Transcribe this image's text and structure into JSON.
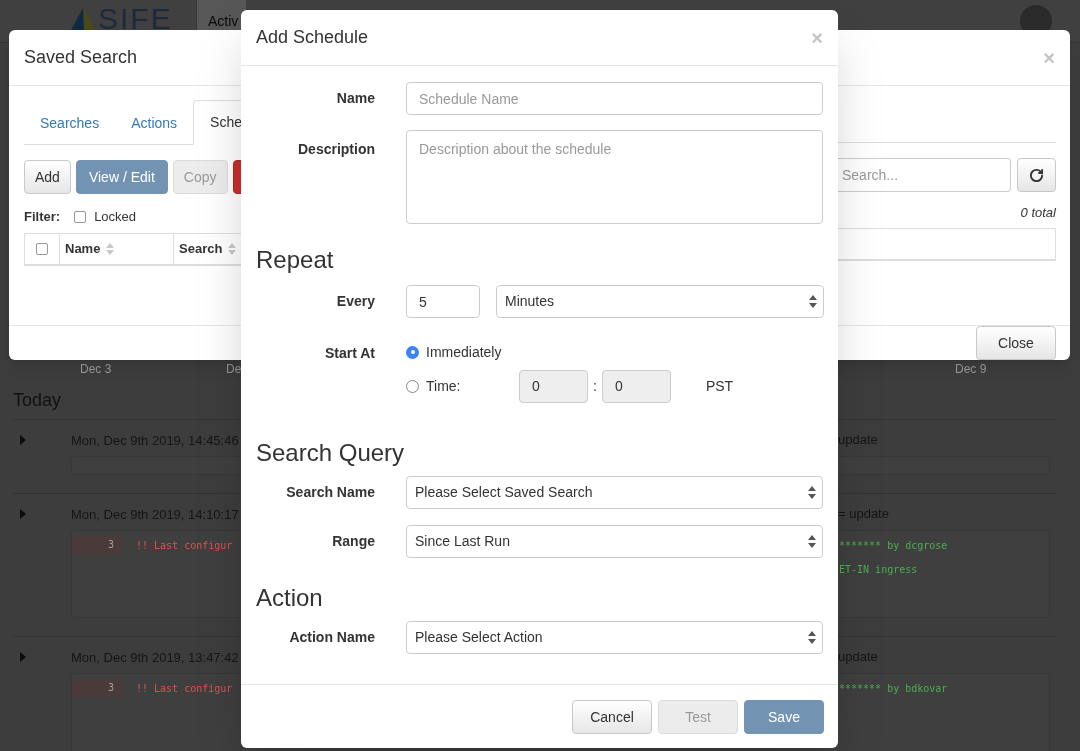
{
  "background": {
    "logo": "SIFE",
    "nav_tab": "Activ",
    "timeline_labels": [
      "Dec 3",
      "De",
      "Dec 9"
    ],
    "section_title": "Today",
    "entries": [
      {
        "timestamp": "Mon, Dec 9th 2019, 14:45:46",
        "title_fragment": "update"
      },
      {
        "timestamp": "Mon, Dec 9th 2019, 14:10:17",
        "title_fragment": "= update",
        "code_lines": [
          {
            "line_number": "3",
            "left": "!! Last configur",
            "right": "******* by dcgrose"
          },
          {
            "right": "ET-IN ingress"
          }
        ]
      },
      {
        "timestamp": "Mon, Dec 9th 2019, 13:47:42",
        "title_fragment": "update",
        "code_lines": [
          {
            "line_number": "3",
            "left": "!! Last configur",
            "right": "******* by bdkovar"
          }
        ]
      }
    ]
  },
  "saved_search": {
    "title": "Saved Search",
    "close": "×",
    "tabs": [
      {
        "label": "Searches",
        "selected": false
      },
      {
        "label": "Actions",
        "selected": false
      },
      {
        "label": "Sche",
        "selected": true
      }
    ],
    "toolbar": [
      {
        "label": "Add",
        "kind": "default"
      },
      {
        "label": "View / Edit",
        "kind": "primary"
      },
      {
        "label": "Copy",
        "kind": "disabled"
      },
      {
        "kind": "danger"
      }
    ],
    "search": {
      "placeholder": "Search..."
    },
    "filter": {
      "label": "Filter:",
      "options": [
        {
          "label": "Locked",
          "checked": false
        }
      ]
    },
    "total": "0 total",
    "table": {
      "select_all_checked": false,
      "columns": [
        "Name",
        "Search"
      ]
    },
    "close_button": "Close"
  },
  "add_schedule": {
    "title": "Add Schedule",
    "close": "×",
    "name": {
      "label": "Name",
      "placeholder": "Schedule Name"
    },
    "description": {
      "label": "Description",
      "placeholder": "Description about the schedule"
    },
    "repeat": {
      "heading": "Repeat",
      "every_label": "Every",
      "every_value": "5",
      "unit": "Minutes",
      "start_label": "Start At",
      "start_options": [
        {
          "label": "Immediately",
          "selected": true
        },
        {
          "label": "Time:",
          "selected": false
        }
      ],
      "hour": "0",
      "separator": ":",
      "minute": "0",
      "timezone": "PST"
    },
    "search_query": {
      "heading": "Search Query",
      "fields": [
        {
          "label": "Search Name",
          "value": "Please Select Saved Search"
        },
        {
          "label": "Range",
          "value": "Since Last Run"
        }
      ]
    },
    "action": {
      "heading": "Action",
      "fields": [
        {
          "label": "Action Name",
          "value": "Please Select Action"
        }
      ]
    },
    "buttons": [
      {
        "label": "Cancel",
        "kind": "default"
      },
      {
        "label": "Test",
        "kind": "disabled"
      },
      {
        "label": "Save",
        "kind": "primary"
      }
    ]
  }
}
